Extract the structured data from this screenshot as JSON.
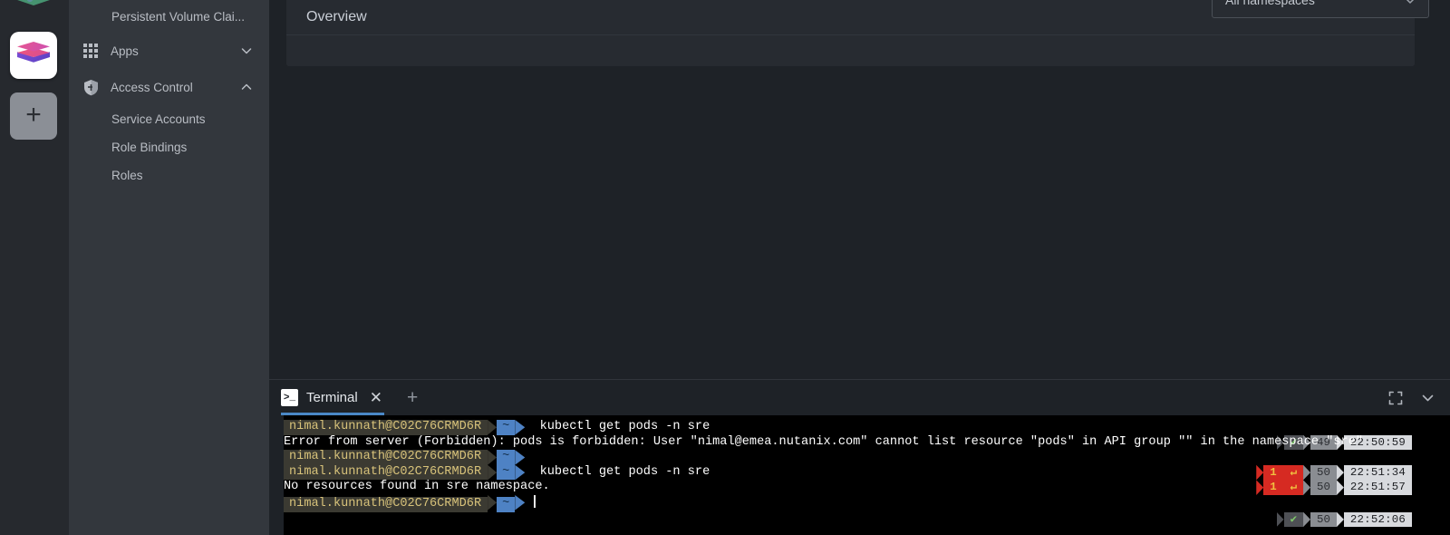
{
  "rail": {
    "items": [
      {
        "name": "cluster-icon-green",
        "label": ""
      },
      {
        "name": "cluster-icon-active",
        "label": ""
      },
      {
        "name": "add-cluster",
        "label": "+"
      }
    ]
  },
  "sidebar": {
    "items": [
      {
        "label": "Persistent Volume Clai...",
        "icon": "none",
        "level": "child",
        "chevron": ""
      },
      {
        "label": "Apps",
        "icon": "grid-icon",
        "level": "parent",
        "chevron": "down"
      },
      {
        "label": "Access Control",
        "icon": "shield-icon",
        "level": "parent",
        "chevron": "up"
      },
      {
        "label": "Service Accounts",
        "icon": "none",
        "level": "child",
        "chevron": ""
      },
      {
        "label": "Role Bindings",
        "icon": "none",
        "level": "child",
        "chevron": ""
      },
      {
        "label": "Roles",
        "icon": "none",
        "level": "child",
        "chevron": ""
      }
    ]
  },
  "main": {
    "card_title": "Overview",
    "namespace_select": {
      "value": "All namespaces",
      "icon": "chevron-down-icon"
    }
  },
  "terminal": {
    "tab_label": "Terminal",
    "tab_icon": ">_",
    "close_icon": "✕",
    "add_icon": "+",
    "controls": [
      {
        "name": "expand-icon"
      },
      {
        "name": "chevron-down-icon"
      }
    ],
    "prompt_user": "nimal.kunnath@C02C76CRMD6R",
    "prompt_path": "~",
    "lines": [
      {
        "type": "prompt",
        "command": "kubectl get pods -n sre",
        "status": {
          "kind": "ok",
          "mark": "✔",
          "count": "49",
          "time": "22:50:59"
        }
      },
      {
        "type": "output",
        "text": "Error from server (Forbidden): pods is forbidden: User \"nimal@emea.nutanix.com\" cannot list resource \"pods\" in API group \"\" in the namespace \"sre\""
      },
      {
        "type": "prompt",
        "command": "",
        "status": {
          "kind": "error",
          "mark": "1",
          "arrow": "↵",
          "count": "50",
          "time": "22:51:34"
        }
      },
      {
        "type": "prompt",
        "command": "kubectl get pods -n sre",
        "status": {
          "kind": "error",
          "mark": "1",
          "arrow": "↵",
          "count": "50",
          "time": "22:51:57"
        }
      },
      {
        "type": "output",
        "text": "No resources found in sre namespace."
      },
      {
        "type": "prompt",
        "command": "",
        "cursor": true,
        "status": {
          "kind": "ok",
          "mark": "✔",
          "count": "50",
          "time": "22:52:06"
        }
      }
    ]
  },
  "colors": {
    "accent": "#4a88c7",
    "prompt_user_bg": "#3b3a32",
    "prompt_user_fg": "#d7c27a",
    "prompt_path_bg": "#4e82c4",
    "status_error_bg": "#d62a22",
    "status_ok_fg": "#7fc56b"
  }
}
